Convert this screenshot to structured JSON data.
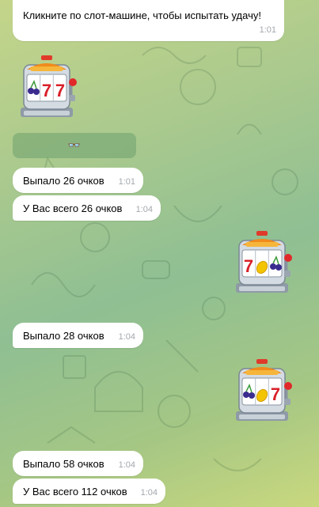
{
  "messages": {
    "intro": {
      "text": "Кликните по слот-машине, чтобы испытать удачу!",
      "time": "1:01"
    },
    "m1": {
      "text": "Выпало 26 очков",
      "time": "1:01"
    },
    "m2": {
      "text": "У Вас всего 26 очков",
      "time": "1:04"
    },
    "m3": {
      "text": "Выпало 28 очков",
      "time": "1:04"
    },
    "m4": {
      "text": "Выпало 58 очков",
      "time": "1:04"
    },
    "m5": {
      "text": "У Вас всего 112 очков",
      "time": "1:04"
    }
  },
  "keyboard": {
    "label": "👓"
  },
  "stickers": {
    "s1": {
      "name": "slot-machine",
      "reels": [
        "cherry",
        "seven",
        "seven"
      ]
    },
    "s2": {
      "name": "slot-machine",
      "reels": [
        "seven",
        "lemon",
        "cherry"
      ]
    },
    "s3": {
      "name": "slot-machine",
      "reels": [
        "cherry",
        "lemon",
        "seven"
      ]
    }
  },
  "colors": {
    "bubble": "#ffffff",
    "time": "#a3a8ad",
    "seven": "#d8202a",
    "cherry": "#3a2b8f",
    "lemon": "#f3c400"
  }
}
